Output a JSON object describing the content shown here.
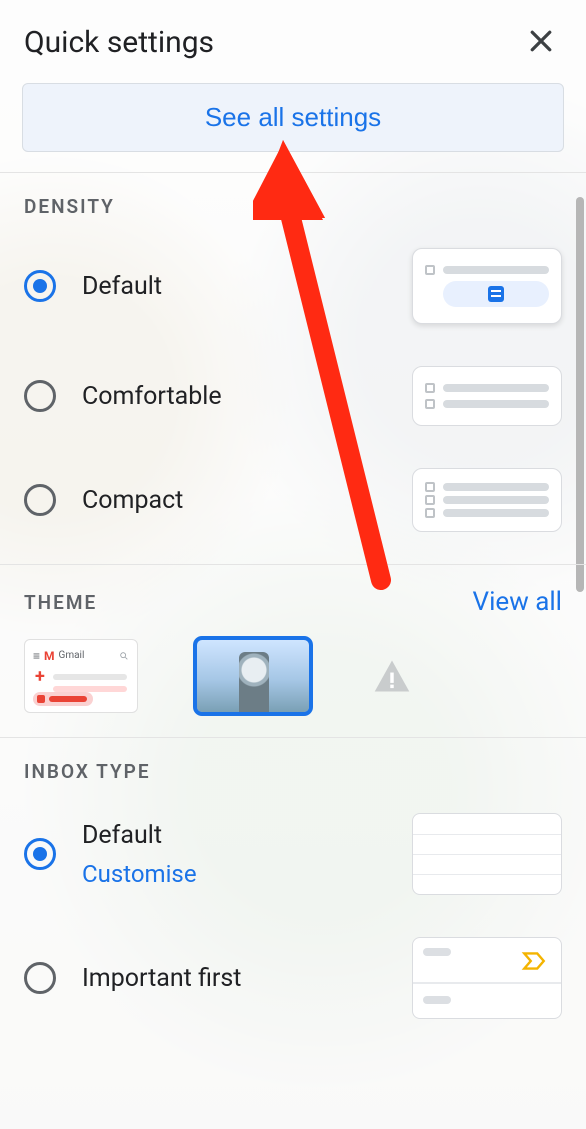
{
  "header": {
    "title": "Quick settings"
  },
  "see_all": "See all settings",
  "density": {
    "title": "DENSITY",
    "options": [
      {
        "label": "Default",
        "selected": true
      },
      {
        "label": "Comfortable",
        "selected": false
      },
      {
        "label": "Compact",
        "selected": false
      }
    ]
  },
  "theme": {
    "title": "THEME",
    "view_all": "View all",
    "swatches": [
      {
        "name": "gmail-default",
        "selected": false
      },
      {
        "name": "photo-binoculars",
        "selected": true
      },
      {
        "name": "high-contrast",
        "selected": false
      }
    ]
  },
  "inbox_type": {
    "title": "INBOX TYPE",
    "options": [
      {
        "label": "Default",
        "customise": "Customise",
        "selected": true
      },
      {
        "label": "Important first",
        "selected": false
      }
    ]
  }
}
